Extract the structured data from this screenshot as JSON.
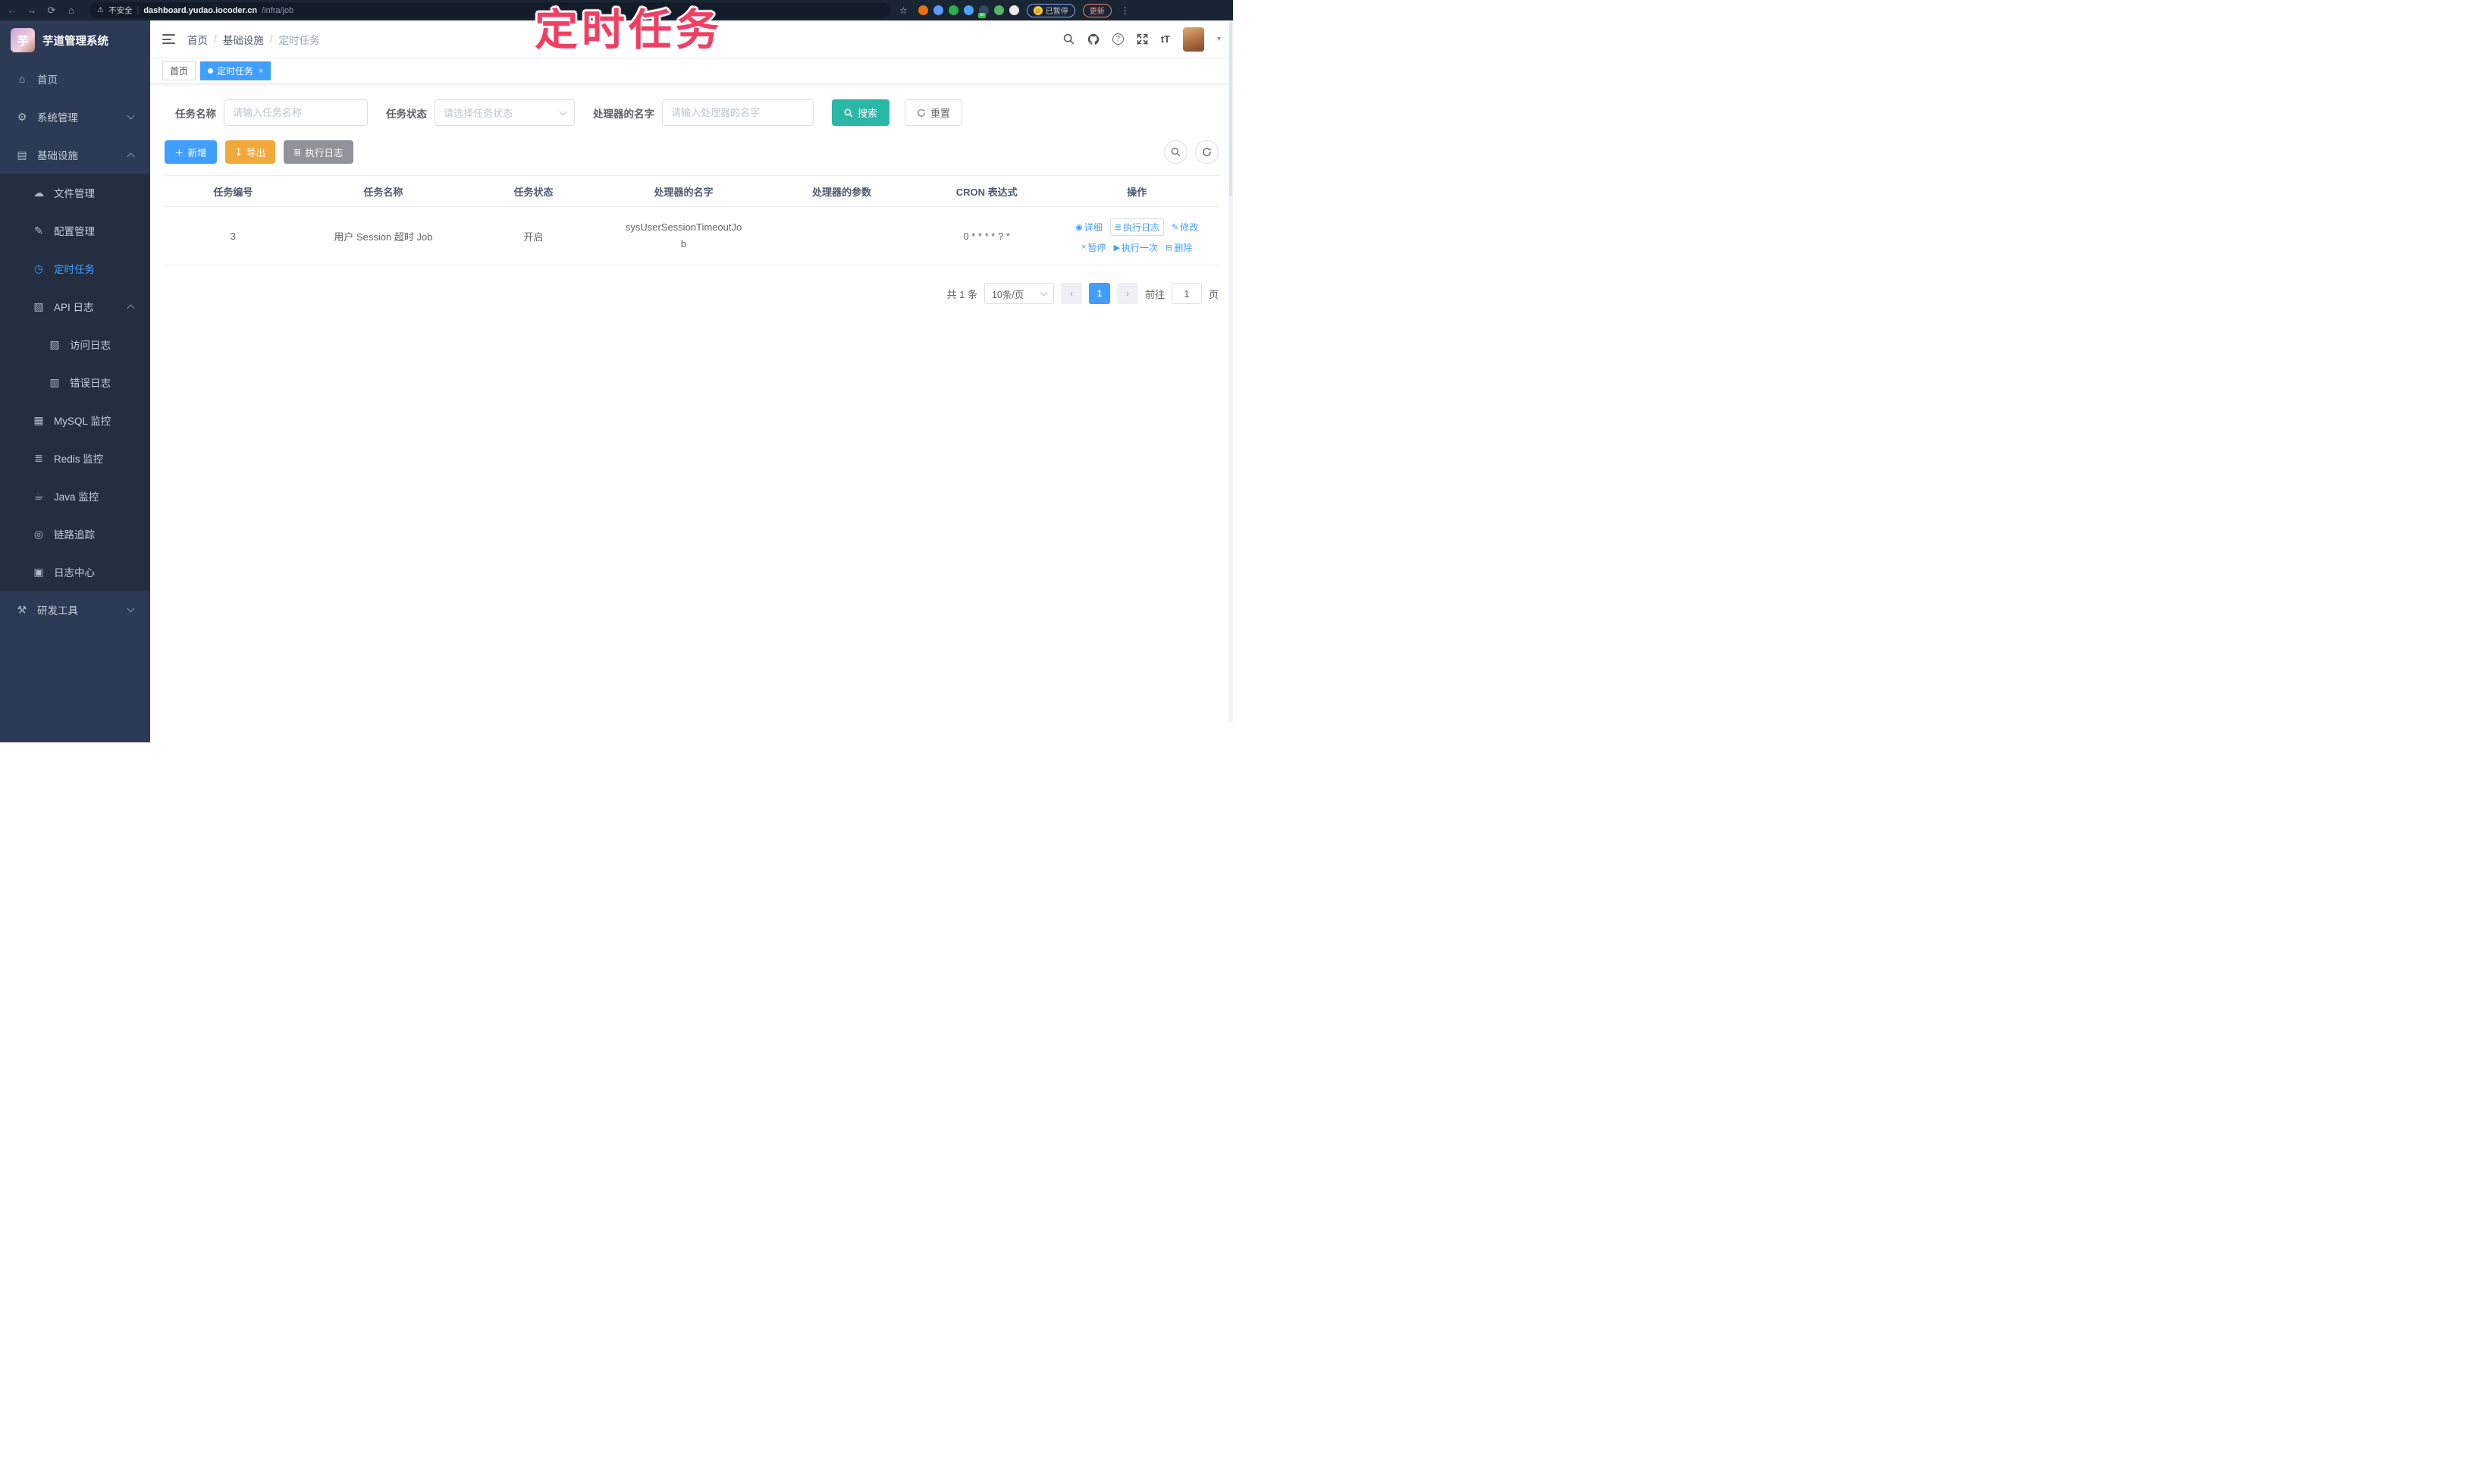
{
  "browser": {
    "warning_label": "不安全",
    "url_host": "dashboard.yudao.iocoder.cn",
    "url_path": "/infra/job",
    "paused_label": "已暂停",
    "update_label": "更新",
    "extensions": [
      {
        "name": "extension-orange-icon",
        "color": "#e8710a"
      },
      {
        "name": "extension-blue-icon",
        "color": "#5b9bf8"
      },
      {
        "name": "extension-green-check-icon",
        "color": "#2bb24c"
      },
      {
        "name": "extension-lighthouse-icon",
        "color": "#4aa3ff"
      },
      {
        "name": "extension-proxy-icon",
        "color": "#35495e",
        "badge": "on"
      },
      {
        "name": "extension-leaf-icon",
        "color": "#58b368"
      },
      {
        "name": "extension-white-star-icon",
        "color": "#e8eaed"
      }
    ]
  },
  "overlay": {
    "annotation": "定时任务"
  },
  "sidebar": {
    "app_title": "芋道管理系统",
    "items": [
      {
        "key": "home",
        "label": "首页",
        "glyph": "⌂",
        "icon": "home-icon",
        "level": 1
      },
      {
        "key": "system",
        "label": "系统管理",
        "glyph": "⚙",
        "icon": "gear-icon",
        "level": 1,
        "arrow": "down"
      },
      {
        "key": "infra",
        "label": "基础设施",
        "glyph": "▤",
        "icon": "infra-icon",
        "level": 1,
        "arrow": "up"
      },
      {
        "key": "file",
        "label": "文件管理",
        "glyph": "☁",
        "icon": "cloud-upload-icon",
        "level": 2,
        "sub": true
      },
      {
        "key": "config",
        "label": "配置管理",
        "glyph": "✎",
        "icon": "edit-icon",
        "level": 2,
        "sub": true
      },
      {
        "key": "job",
        "label": "定时任务",
        "glyph": "◷",
        "icon": "timer-icon",
        "level": 2,
        "sub": true,
        "active": true
      },
      {
        "key": "api-log",
        "label": "API 日志",
        "glyph": "▧",
        "icon": "api-log-icon",
        "level": 2,
        "sub": true,
        "arrow": "up"
      },
      {
        "key": "access-log",
        "label": "访问日志",
        "glyph": "▨",
        "icon": "access-log-icon",
        "level": 3,
        "sub": true
      },
      {
        "key": "error-log",
        "label": "错误日志",
        "glyph": "▥",
        "icon": "error-log-icon",
        "level": 3,
        "sub": true
      },
      {
        "key": "mysql",
        "label": "MySQL 监控",
        "glyph": "▦",
        "icon": "mysql-icon",
        "level": 2,
        "sub": true
      },
      {
        "key": "redis",
        "label": "Redis 监控",
        "glyph": "≣",
        "icon": "redis-icon",
        "level": 2,
        "sub": true
      },
      {
        "key": "java",
        "label": "Java 监控",
        "glyph": "☕",
        "icon": "java-icon",
        "level": 2,
        "sub": true
      },
      {
        "key": "trace",
        "label": "链路追踪",
        "glyph": "◎",
        "icon": "trace-icon",
        "level": 2,
        "sub": true
      },
      {
        "key": "log-center",
        "label": "日志中心",
        "glyph": "▣",
        "icon": "log-center-icon",
        "level": 2,
        "sub": true
      },
      {
        "key": "dev-tools",
        "label": "研发工具",
        "glyph": "⚒",
        "icon": "toolbox-icon",
        "level": 1,
        "arrow": "down"
      }
    ]
  },
  "navbar": {
    "breadcrumb": [
      "首页",
      "基础设施",
      "定时任务"
    ],
    "breadcrumb_separator": "/",
    "font_icon_text": "tT"
  },
  "tags": [
    {
      "label": "首页",
      "active": false
    },
    {
      "label": "定时任务",
      "active": true,
      "closable": true
    }
  ],
  "filters": {
    "name_label": "任务名称",
    "name_placeholder": "请输入任务名称",
    "status_label": "任务状态",
    "status_placeholder": "请选择任务状态",
    "handler_label": "处理器的名字",
    "handler_placeholder": "请输入处理器的名字",
    "search_label": "搜索",
    "reset_label": "重置"
  },
  "toolbar": {
    "add_label": "新增",
    "add_icon": "＋",
    "export_label": "导出",
    "export_icon": "↧",
    "exec_log_label": "执行日志",
    "exec_log_icon": "≣"
  },
  "table": {
    "columns": [
      "任务编号",
      "任务名称",
      "任务状态",
      "处理器的名字",
      "处理器的参数",
      "CRON 表达式",
      "操作"
    ],
    "rows": [
      {
        "id": "3",
        "name": "用户 Session 超时 Job",
        "status": "开启",
        "handler": "sysUserSessionTimeoutJob",
        "param": "",
        "cron": "0 * * * * ? *"
      }
    ],
    "row_actions": [
      "详细",
      "执行日志",
      "修改",
      "暂停",
      "执行一次",
      "删除"
    ],
    "row_action_icons": [
      "◉",
      "≣",
      "✎",
      "×",
      "▶",
      "⊟"
    ]
  },
  "pagination": {
    "total": "共 1 条",
    "page_size": "10条/页",
    "current_page": "1",
    "goto_label": "前往",
    "goto_value": "1",
    "page_unit": "页"
  },
  "colors": {
    "accent_blue": "#409eff",
    "search_teal": "#2bb7a5",
    "export_orange": "#f2a93c",
    "info_gray": "#909399",
    "sidebar_bg": "#2d3a55",
    "sidebar_sub_bg": "#232e40",
    "chrome_bg": "#1a2533",
    "watermark_pink": "#f13f63"
  }
}
